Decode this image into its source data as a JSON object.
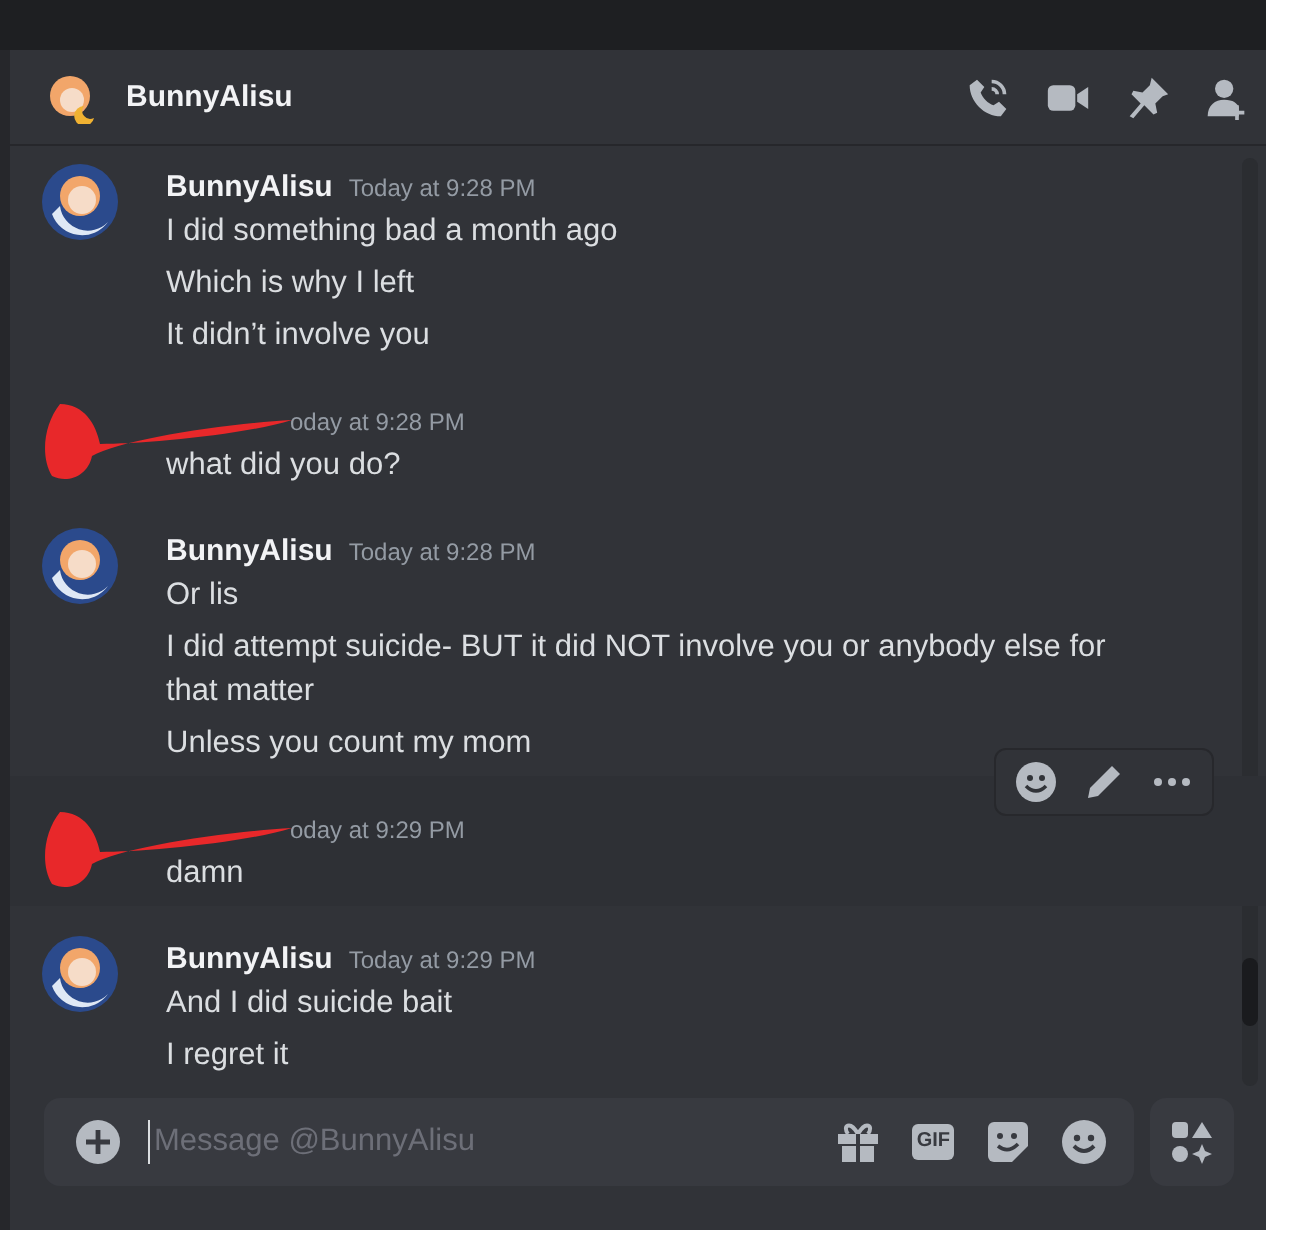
{
  "header": {
    "title": "BunnyAlisu"
  },
  "messages": [
    {
      "redacted": false,
      "author": "BunnyAlisu",
      "time": "Today at 9:28 PM",
      "hovered": false,
      "lines": [
        "I did something bad a month ago",
        "Which is why I left",
        "It didn’t involve you"
      ]
    },
    {
      "redacted": true,
      "time": "oday at 9:28 PM",
      "hovered": false,
      "lines": [
        "what did you do?"
      ]
    },
    {
      "redacted": false,
      "author": "BunnyAlisu",
      "time": "Today at 9:28 PM",
      "hovered": false,
      "lines": [
        "Or lis",
        "I did attempt suicide- BUT it did NOT involve you or anybody else for that matter",
        "Unless you count my mom"
      ]
    },
    {
      "redacted": true,
      "time": "oday at 9:29 PM",
      "hovered": true,
      "lines": [
        "damn"
      ]
    },
    {
      "redacted": false,
      "author": "BunnyAlisu",
      "time": "Today at 9:29 PM",
      "hovered": false,
      "lines": [
        "And I did suicide bait",
        "I regret it"
      ]
    }
  ],
  "composer": {
    "placeholder": "Message @BunnyAlisu",
    "gif_label": "GIF"
  }
}
